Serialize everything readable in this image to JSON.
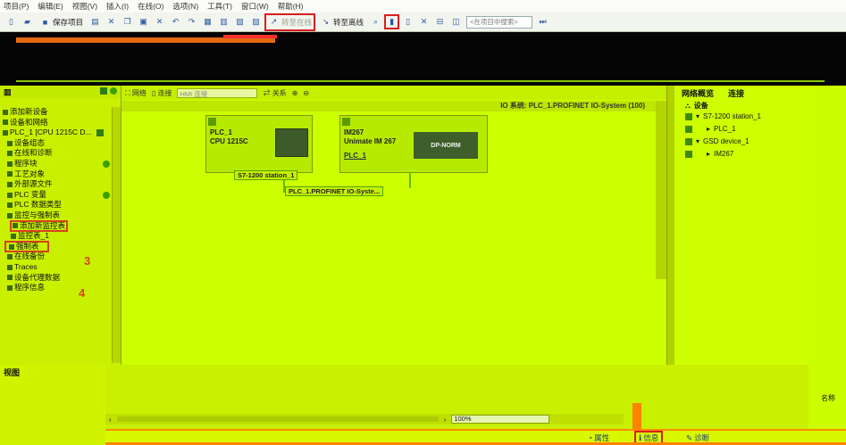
{
  "menu": [
    "项目(P)",
    "编辑(E)",
    "视图(V)",
    "插入(I)",
    "在线(O)",
    "选项(N)",
    "工具(T)",
    "窗口(W)",
    "帮助(H)"
  ],
  "toolbar": {
    "save_label": "保存项目",
    "go_online_label": "转至在线",
    "go_offline_label": "转至离线",
    "search_placeholder": "<在项目中搜索>"
  },
  "tree": {
    "items": [
      {
        "label": "添加新设备"
      },
      {
        "label": "设备和网络"
      },
      {
        "label": "PLC_1 [CPU 1215C D..."
      },
      {
        "label": "设备组态"
      },
      {
        "label": "在线和诊断"
      },
      {
        "label": "程序块"
      },
      {
        "label": "工艺对象"
      },
      {
        "label": "外部源文件"
      },
      {
        "label": "PLC 变量"
      },
      {
        "label": "PLC 数据类型"
      },
      {
        "label": "监控与强制表"
      },
      {
        "label": "添加新监控表"
      },
      {
        "label": "监控表_1"
      },
      {
        "label": "强制表"
      },
      {
        "label": "在线备份"
      },
      {
        "label": "Traces"
      },
      {
        "label": "设备代理数据"
      },
      {
        "label": "程序信息"
      }
    ],
    "annotation_3": "3",
    "annotation_4": "4"
  },
  "details": {
    "title": "视图"
  },
  "network": {
    "toolbar": {
      "network_label": "网络",
      "connections_label": "连接",
      "connection_select": "HMI 连接",
      "relations_label": "关系"
    },
    "io_system_header": "IO 系统: PLC_1.PROFINET IO-System (100)",
    "plc": {
      "name": "PLC_1",
      "cpu": "CPU 1215C"
    },
    "im": {
      "name": "IM267",
      "type": "Unimate IM 267",
      "link": "PLC_1",
      "module": "DP-NORM"
    },
    "station_label": "S7-1200 station_1",
    "subnet_label": "PLC_1.PROFINET IO-Syste..."
  },
  "zoom": {
    "value": "100%"
  },
  "overview": {
    "tab_overview": "网络概览",
    "tab_connections": "连接",
    "devices_label": "设备",
    "rows": [
      {
        "label": "S7-1200 station_1",
        "level": 0
      },
      {
        "label": "PLC_1",
        "level": 1
      },
      {
        "label": "GSD device_1",
        "level": 0
      },
      {
        "label": "IM267",
        "level": 1
      }
    ],
    "name_col": "名称"
  },
  "bottom_tabs": {
    "properties": "属性",
    "info": "信息",
    "diagnostics": "诊断"
  }
}
